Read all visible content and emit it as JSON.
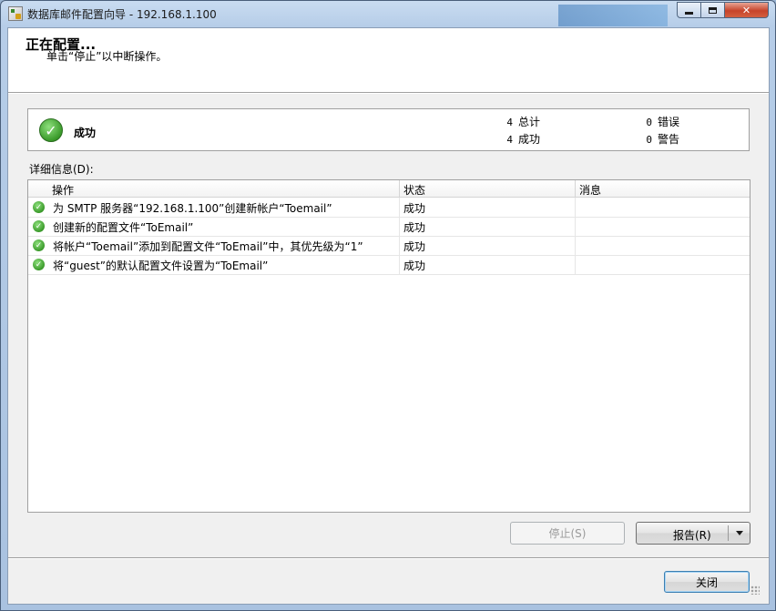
{
  "window": {
    "title": "数据库邮件配置向导 - 192.168.1.100",
    "minimize": "minimize",
    "maximize": "maximize",
    "close_glyph": "✕"
  },
  "header": {
    "title": "正在配置...",
    "subtitle": "单击“停止”以中断操作。"
  },
  "status": {
    "icon": "success-check-icon",
    "label": "成功",
    "total_count": "4",
    "total_label": "总计",
    "success_count": "4",
    "success_label": "成功",
    "error_count": "0",
    "error_label": "错误",
    "warning_count": "0",
    "warning_label": "警告"
  },
  "details": {
    "label": "详细信息(D):",
    "columns": [
      "操作",
      "状态",
      "消息"
    ],
    "rows": [
      {
        "action": "为 SMTP 服务器“192.168.1.100”创建新帐户“Toemail”",
        "status": "成功",
        "message": ""
      },
      {
        "action": "创建新的配置文件“ToEmail”",
        "status": "成功",
        "message": ""
      },
      {
        "action": "将帐户“Toemail”添加到配置文件“ToEmail”中，其优先级为“1”",
        "status": "成功",
        "message": ""
      },
      {
        "action": "将“guest”的默认配置文件设置为“ToEmail”",
        "status": "成功",
        "message": ""
      }
    ]
  },
  "buttons": {
    "stop": "停止(S)",
    "report": "报告(R)",
    "close": "关闭"
  },
  "colors": {
    "success_green": "#3a9a2a",
    "close_button_red": "#c7442a",
    "title_bar_blue": "#b6cde8"
  }
}
